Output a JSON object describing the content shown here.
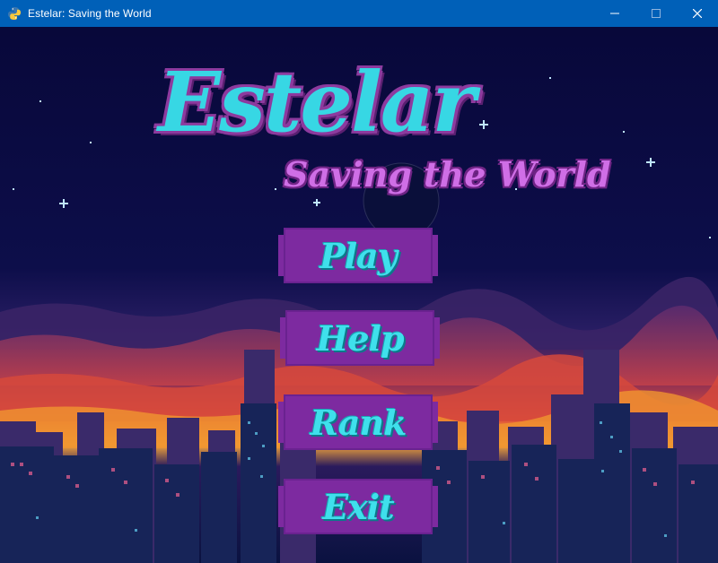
{
  "window": {
    "title": "Estelar: Saving the World",
    "app_icon": "python-snake-icon",
    "controls": [
      "minimize-icon",
      "maximize-icon",
      "close-icon"
    ]
  },
  "logo": {
    "title": "Estelar",
    "subtitle": "Saving the World"
  },
  "menu": {
    "play": "Play",
    "help": "Help",
    "rank": "Rank",
    "exit": "Exit"
  },
  "colors": {
    "titlebar": "#0060b8",
    "sky_top": "#0a0a3a",
    "button_bg": "#7d2aa0",
    "button_text": "#3fe0ec",
    "logo_main": "#37d7e4",
    "logo_sub": "#cf6ee6"
  }
}
